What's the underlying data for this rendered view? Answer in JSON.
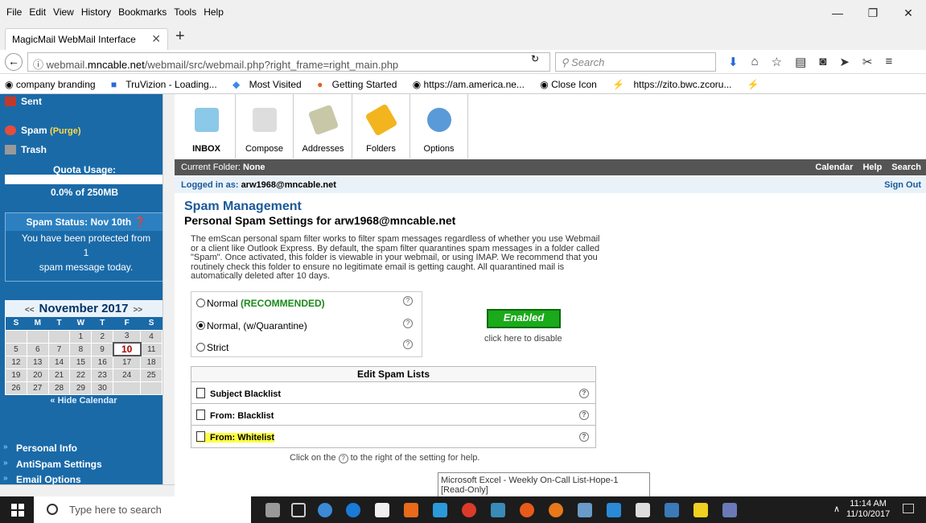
{
  "menubar": {
    "items": [
      "File",
      "Edit",
      "View",
      "History",
      "Bookmarks",
      "Tools",
      "Help"
    ]
  },
  "window_controls": {
    "minimize": "—",
    "restore": "❐",
    "close": "✕"
  },
  "tab": {
    "title": "MagicMail WebMail Interface",
    "close": "✕",
    "new": "+"
  },
  "url": {
    "prefix": "webmail.",
    "domain": "mncable.net",
    "path": "/webmail/src/webmail.php?right_frame=right_main.php",
    "search_placeholder": "Search"
  },
  "bookmarks": [
    "company branding",
    "TruVizion - Loading...",
    "Most Visited",
    "Getting Started",
    "https://am.america.ne...",
    "Close Icon",
    "https://zito.bwc.zcoru..."
  ],
  "sidebar": {
    "folders": [
      "Sent",
      "Spam",
      "Trash"
    ],
    "purge": "(Purge)",
    "quota_label": "Quota Usage:",
    "quota_text": "0.0% of 250MB",
    "quota_fraction": 0.0,
    "spam_title": "Spam Status: Nov 10th",
    "spam_line1": "You have been protected from",
    "spam_count": "1",
    "spam_line2": "spam message today.",
    "nav": [
      "Personal Info",
      "AntiSpam Settings",
      "Email Options"
    ]
  },
  "calendar": {
    "prev": "<<",
    "month": "November 2017",
    "next": ">>",
    "days": [
      "S",
      "M",
      "T",
      "W",
      "T",
      "F",
      "S"
    ],
    "weeks": [
      [
        "",
        "",
        "",
        "1",
        "2",
        "3",
        "4"
      ],
      [
        "5",
        "6",
        "7",
        "8",
        "9",
        "10",
        "11"
      ],
      [
        "12",
        "13",
        "14",
        "15",
        "16",
        "17",
        "18"
      ],
      [
        "19",
        "20",
        "21",
        "22",
        "23",
        "24",
        "25"
      ],
      [
        "26",
        "27",
        "28",
        "29",
        "30",
        "",
        ""
      ]
    ],
    "today": "10",
    "hide": "« Hide Calendar"
  },
  "toolbar": {
    "buttons": [
      "INBOX",
      "Compose",
      "Addresses",
      "Folders",
      "Options"
    ]
  },
  "folderbar": {
    "label": "Current Folder:",
    "value": "None",
    "links": [
      "Calendar",
      "Help",
      "Search"
    ]
  },
  "loginbar": {
    "label": "Logged in as:",
    "user": "arw1968@mncable.net",
    "signout": "Sign Out"
  },
  "main": {
    "title": "Spam Management",
    "subtitle": "Personal Spam Settings for arw1968@mncable.net",
    "description": "The emScan personal spam filter works to filter spam messages regardless of whether you use Webmail or a client like Outlook Express. By default, the spam filter quarantines spam messages in a folder called \"Spam\". Once activated, this folder is viewable in your webmail, or using IMAP. We recommend that you routinely check this folder to ensure no legitimate email is getting caught. All quarantined mail is automatically deleted after 10 days.",
    "opt_normal": "Normal",
    "opt_recommended": "(RECOMMENDED)",
    "opt_quarantine": "Normal, (w/Quarantine)",
    "opt_strict": "Strict",
    "enabled": "Enabled",
    "disable_hint": "click here to disable",
    "lists_header": "Edit Spam Lists",
    "lists": [
      "Subject Blacklist",
      "From: Blacklist",
      "From: Whitelist"
    ],
    "help_prefix": "Click on the",
    "help_suffix": "to the right of the setting for help.",
    "help_glyph": "?"
  },
  "tooltip": "Microsoft Excel - Weekly On-Call List-Hope-1  [Read-Only]",
  "taskbar": {
    "search": "Type here to search",
    "time": "11:14 AM",
    "date": "11/10/2017"
  },
  "colors": {
    "sidebar": "#1a6aa8",
    "accent": "#1a5a99",
    "enabled": "#1aaa1a",
    "highlight": "#ffff44"
  }
}
